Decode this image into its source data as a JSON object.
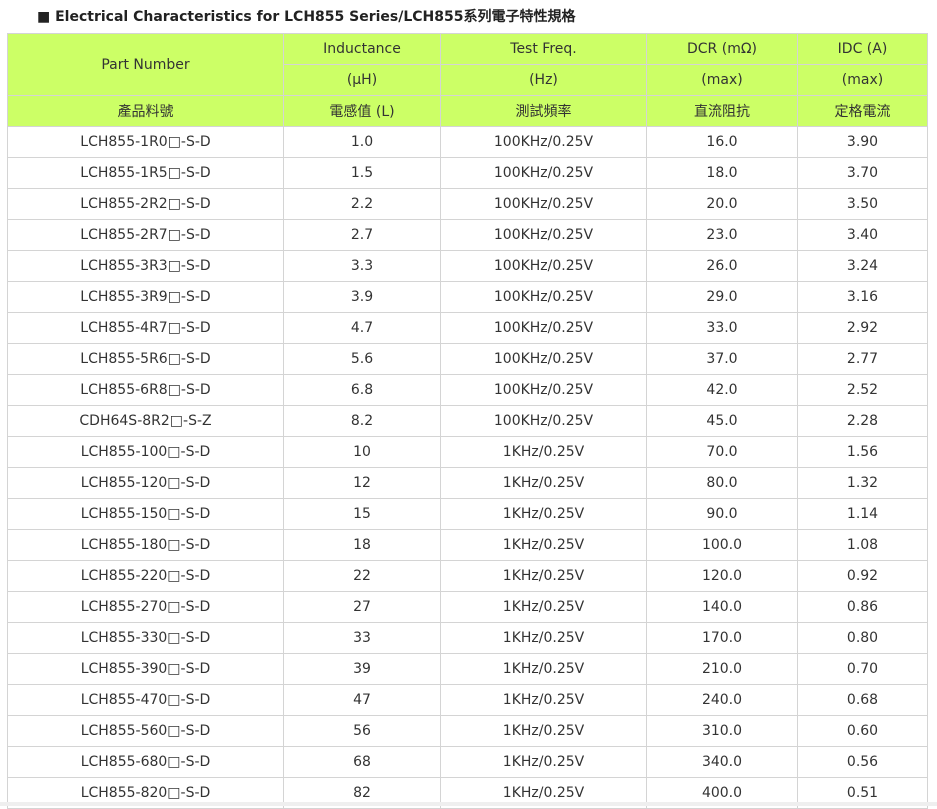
{
  "title": "■ Electrical Characteristics for LCH855 Series/LCH855系列電子特性規格",
  "colors": {
    "header_bg": "#ccff66",
    "border": "#d4d4d4",
    "text": "#333333"
  },
  "table": {
    "header": {
      "part_number": "Part Number",
      "inductance": "Inductance",
      "inductance_unit": "(μH)",
      "test_freq": "Test Freq.",
      "test_freq_unit": "(Hz)",
      "dcr": "DCR (mΩ)",
      "dcr_unit": "(max)",
      "idc": "IDC (A)",
      "idc_unit": "(max)",
      "part_number_cn": "產品料號",
      "inductance_cn": "電感值 (L)",
      "test_freq_cn": "測試頻率",
      "dcr_cn": "直流阻抗",
      "idc_cn": "定格電流"
    },
    "rows": [
      [
        "LCH855-1R0□-S-D",
        "1.0",
        "100KHz/0.25V",
        "16.0",
        "3.90"
      ],
      [
        "LCH855-1R5□-S-D",
        "1.5",
        "100KHz/0.25V",
        "18.0",
        "3.70"
      ],
      [
        "LCH855-2R2□-S-D",
        "2.2",
        "100KHz/0.25V",
        "20.0",
        "3.50"
      ],
      [
        "LCH855-2R7□-S-D",
        "2.7",
        "100KHz/0.25V",
        "23.0",
        "3.40"
      ],
      [
        "LCH855-3R3□-S-D",
        "3.3",
        "100KHz/0.25V",
        "26.0",
        "3.24"
      ],
      [
        "LCH855-3R9□-S-D",
        "3.9",
        "100KHz/0.25V",
        "29.0",
        "3.16"
      ],
      [
        "LCH855-4R7□-S-D",
        "4.7",
        "100KHz/0.25V",
        "33.0",
        "2.92"
      ],
      [
        "LCH855-5R6□-S-D",
        "5.6",
        "100KHz/0.25V",
        "37.0",
        "2.77"
      ],
      [
        "LCH855-6R8□-S-D",
        "6.8",
        "100KHz/0.25V",
        "42.0",
        "2.52"
      ],
      [
        "CDH64S-8R2□-S-Z",
        "8.2",
        "100KHz/0.25V",
        "45.0",
        "2.28"
      ],
      [
        "LCH855-100□-S-D",
        "10",
        "1KHz/0.25V",
        "70.0",
        "1.56"
      ],
      [
        "LCH855-120□-S-D",
        "12",
        "1KHz/0.25V",
        "80.0",
        "1.32"
      ],
      [
        "LCH855-150□-S-D",
        "15",
        "1KHz/0.25V",
        "90.0",
        "1.14"
      ],
      [
        "LCH855-180□-S-D",
        "18",
        "1KHz/0.25V",
        "100.0",
        "1.08"
      ],
      [
        "LCH855-220□-S-D",
        "22",
        "1KHz/0.25V",
        "120.0",
        "0.92"
      ],
      [
        "LCH855-270□-S-D",
        "27",
        "1KHz/0.25V",
        "140.0",
        "0.86"
      ],
      [
        "LCH855-330□-S-D",
        "33",
        "1KHz/0.25V",
        "170.0",
        "0.80"
      ],
      [
        "LCH855-390□-S-D",
        "39",
        "1KHz/0.25V",
        "210.0",
        "0.70"
      ],
      [
        "LCH855-470□-S-D",
        "47",
        "1KHz/0.25V",
        "240.0",
        "0.68"
      ],
      [
        "LCH855-560□-S-D",
        "56",
        "1KHz/0.25V",
        "310.0",
        "0.60"
      ],
      [
        "LCH855-680□-S-D",
        "68",
        "1KHz/0.25V",
        "340.0",
        "0.56"
      ],
      [
        "LCH855-820□-S-D",
        "82",
        "1KHz/0.25V",
        "400.0",
        "0.51"
      ]
    ]
  }
}
